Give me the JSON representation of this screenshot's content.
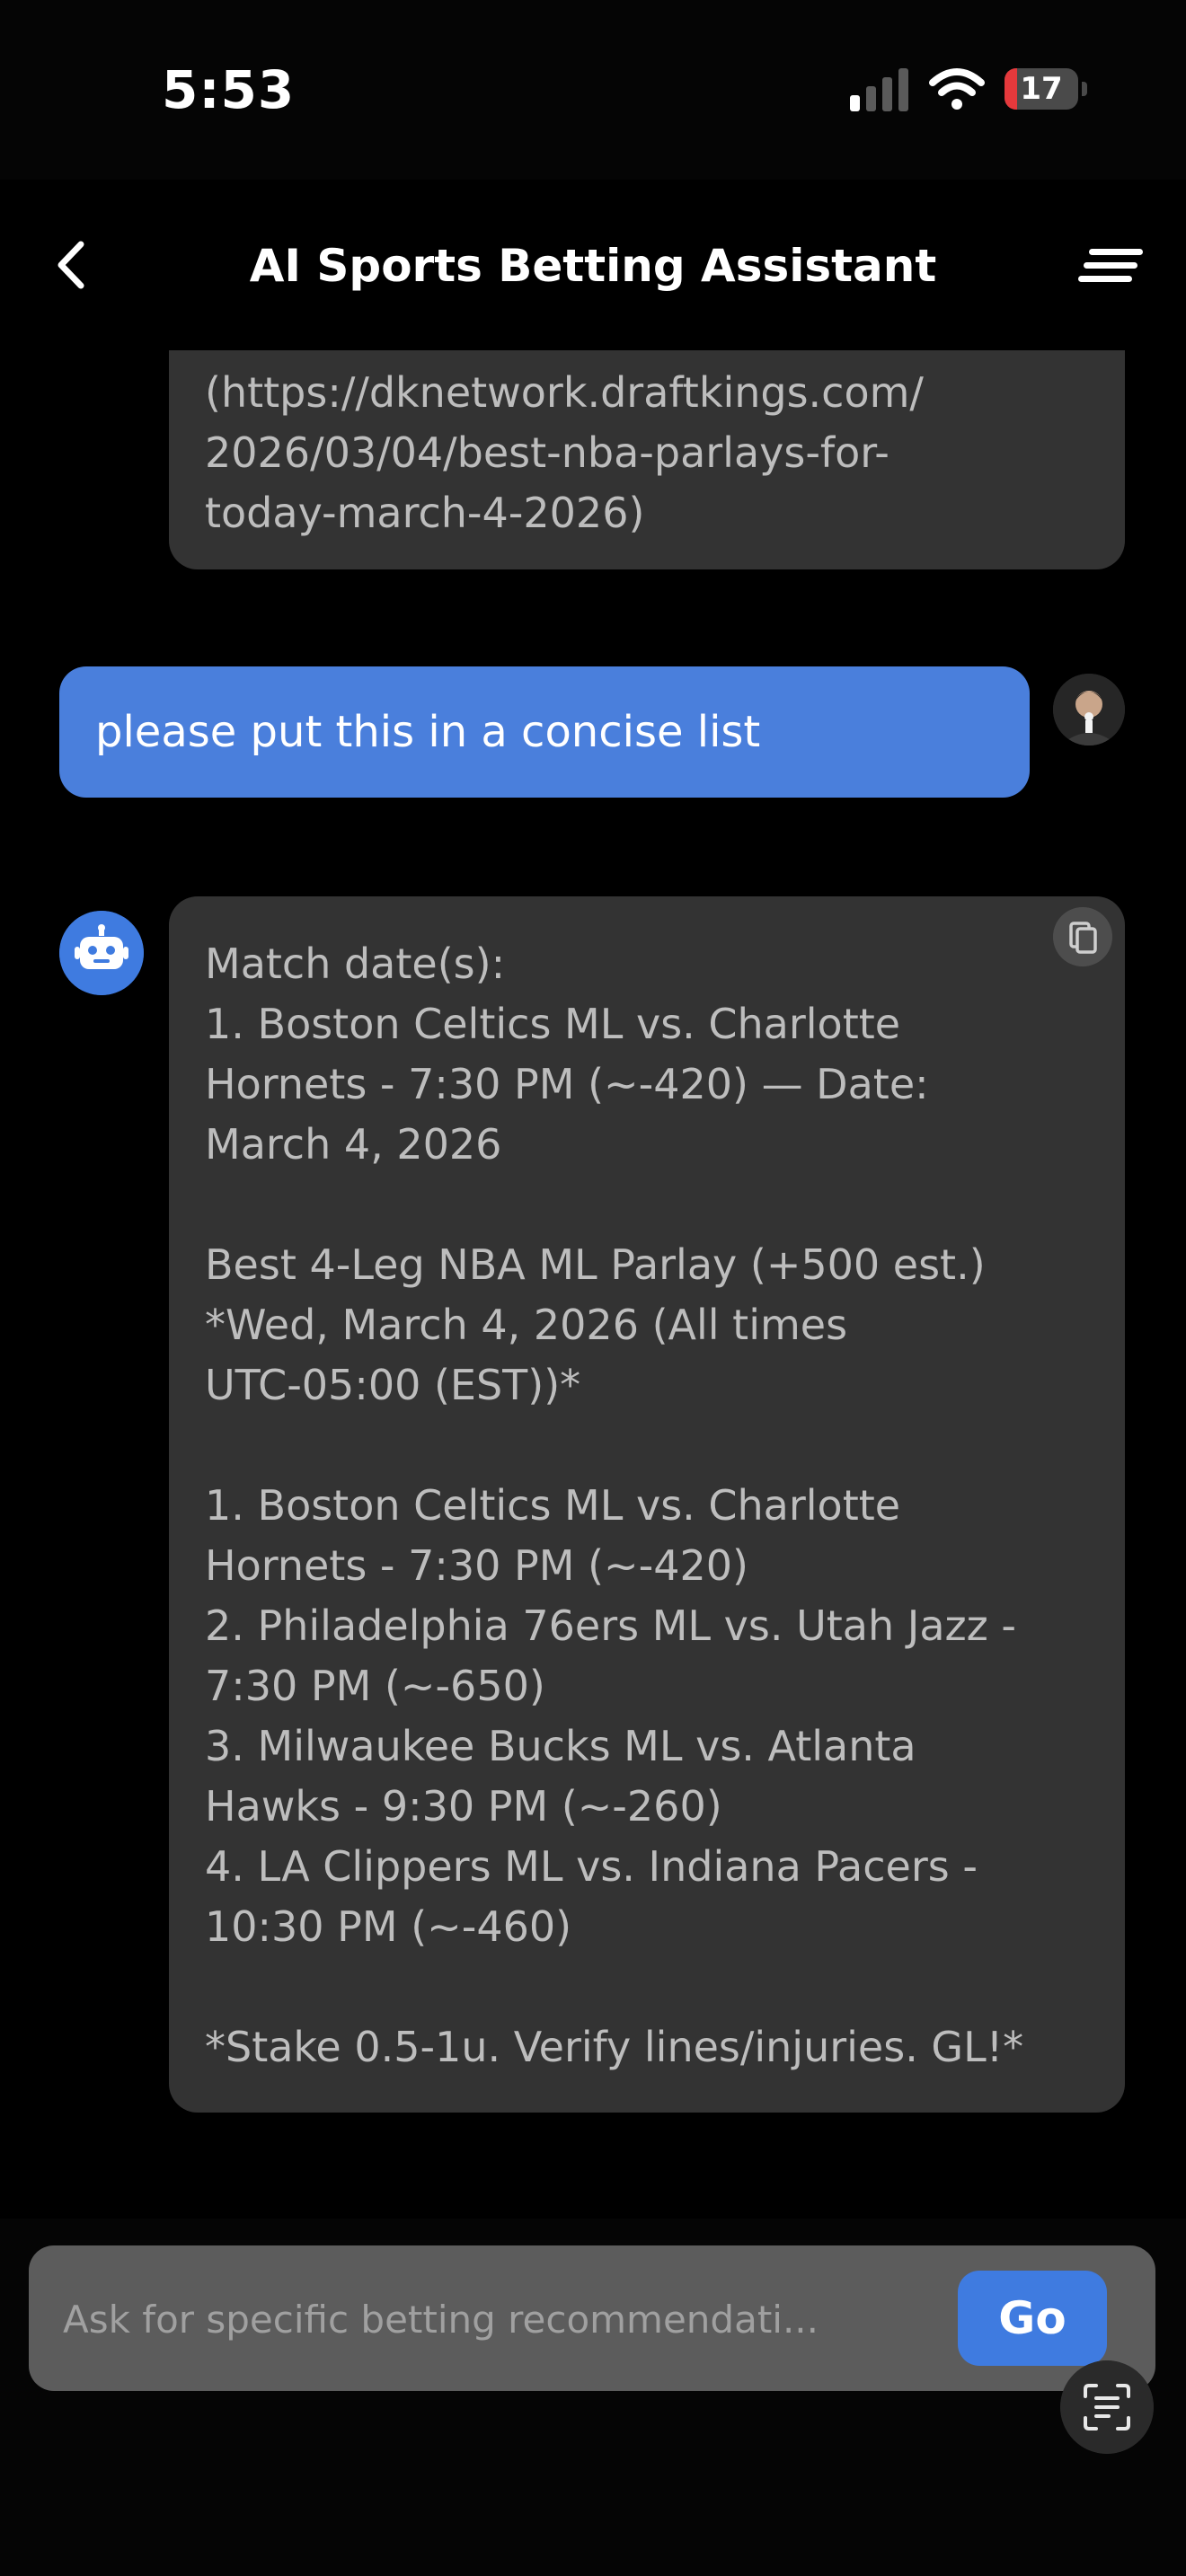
{
  "status_bar": {
    "time": "5:53",
    "battery_level": "17",
    "icons": [
      "signal-icon",
      "wifi-icon",
      "battery-icon"
    ]
  },
  "header": {
    "title": "AI Sports Betting Assistant",
    "icons": [
      "back-chevron-icon",
      "menu-icon"
    ]
  },
  "messages": [
    {
      "role": "assistant",
      "text": "(https://dknetwork.draftkings.com/\n2026/03/04/best-nba-parlays-for-\ntoday-march-4-2026)"
    },
    {
      "role": "user",
      "text": "please put this in a concise list"
    },
    {
      "role": "assistant",
      "text": "Match date(s):\n1. Boston Celtics ML vs. Charlotte\nHornets - 7:30 PM (~-420) — Date:\nMarch 4, 2026\n\nBest 4-Leg NBA ML Parlay (+500 est.)\n*Wed, March 4, 2026 (All times\nUTC-05:00 (EST))*\n\n1. Boston Celtics ML vs. Charlotte\nHornets - 7:30 PM (~-420)\n2. Philadelphia 76ers ML vs. Utah Jazz -\n7:30 PM (~-650)\n3. Milwaukee Bucks ML vs. Atlanta\nHawks - 9:30 PM (~-260)\n4. LA Clippers ML vs. Indiana Pacers -\n10:30 PM (~-460)\n\n*Stake 0.5-1u. Verify lines/injuries. GL!*"
    }
  ],
  "input": {
    "placeholder": "Ask for specific betting recommendati...",
    "value": "",
    "submit_label": "Go"
  },
  "colors": {
    "accent": "#3f7be0",
    "user_bubble": "#4a7fdc",
    "bot_bubble": "#333333",
    "battery_low": "#e5393c"
  }
}
